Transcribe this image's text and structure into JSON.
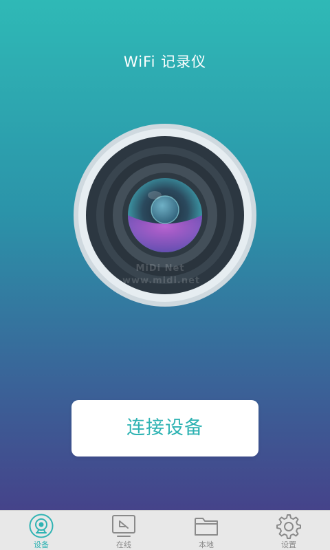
{
  "header": {
    "title": "WiFi 记录仪"
  },
  "watermark": {
    "line1": "MiDi Net",
    "line2": "www.midi.net"
  },
  "main": {
    "connect_label": "连接设备"
  },
  "tabbar": {
    "tabs": [
      {
        "label": "设备",
        "icon": "camera-icon",
        "active": true
      },
      {
        "label": "在线",
        "icon": "online-icon",
        "active": false
      },
      {
        "label": "本地",
        "icon": "folder-icon",
        "active": false
      },
      {
        "label": "设置",
        "icon": "gear-icon",
        "active": false
      }
    ]
  },
  "colors": {
    "accent": "#2fb3b3",
    "gradient_top": "#2fb9b6",
    "gradient_bottom": "#45438a",
    "tab_inactive": "#8a8a8a",
    "tabbar_bg": "#e8e8e8"
  }
}
